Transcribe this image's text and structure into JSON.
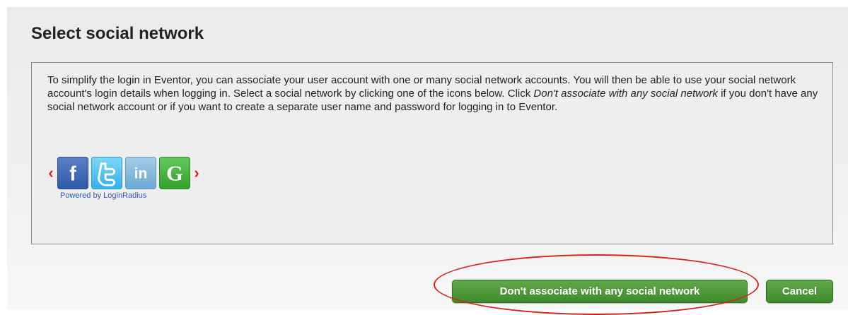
{
  "dialog": {
    "title": "Select social network",
    "description": {
      "part1": "To simplify the login in Eventor, you can associate your user account with one or many social network accounts. You will then be able to use your social network account's login details when logging in. Select a social network by clicking one of the icons below. Click ",
      "emphasis": "Don't associate with any social network",
      "part2": " if you don't have any social network account or if you want to create a separate user name and password for logging in to Eventor."
    },
    "carousel": {
      "prev_arrow": "‹",
      "next_arrow": "›",
      "icons": [
        {
          "name": "facebook-icon",
          "glyph": "f",
          "color": "#3b5ba8"
        },
        {
          "name": "twitter-icon",
          "glyph": "t",
          "color": "#33b2e8"
        },
        {
          "name": "linkedin-icon",
          "glyph": "in",
          "color": "#7fb3db"
        },
        {
          "name": "google-icon",
          "glyph": "G",
          "color": "#3aa832"
        }
      ],
      "powered_by": "Powered by LoginRadius"
    }
  },
  "actions": {
    "associate_none_label": "Don't associate with any social network",
    "cancel_label": "Cancel",
    "button_color": "#4a9634"
  },
  "annotation_color": "#d9201c"
}
